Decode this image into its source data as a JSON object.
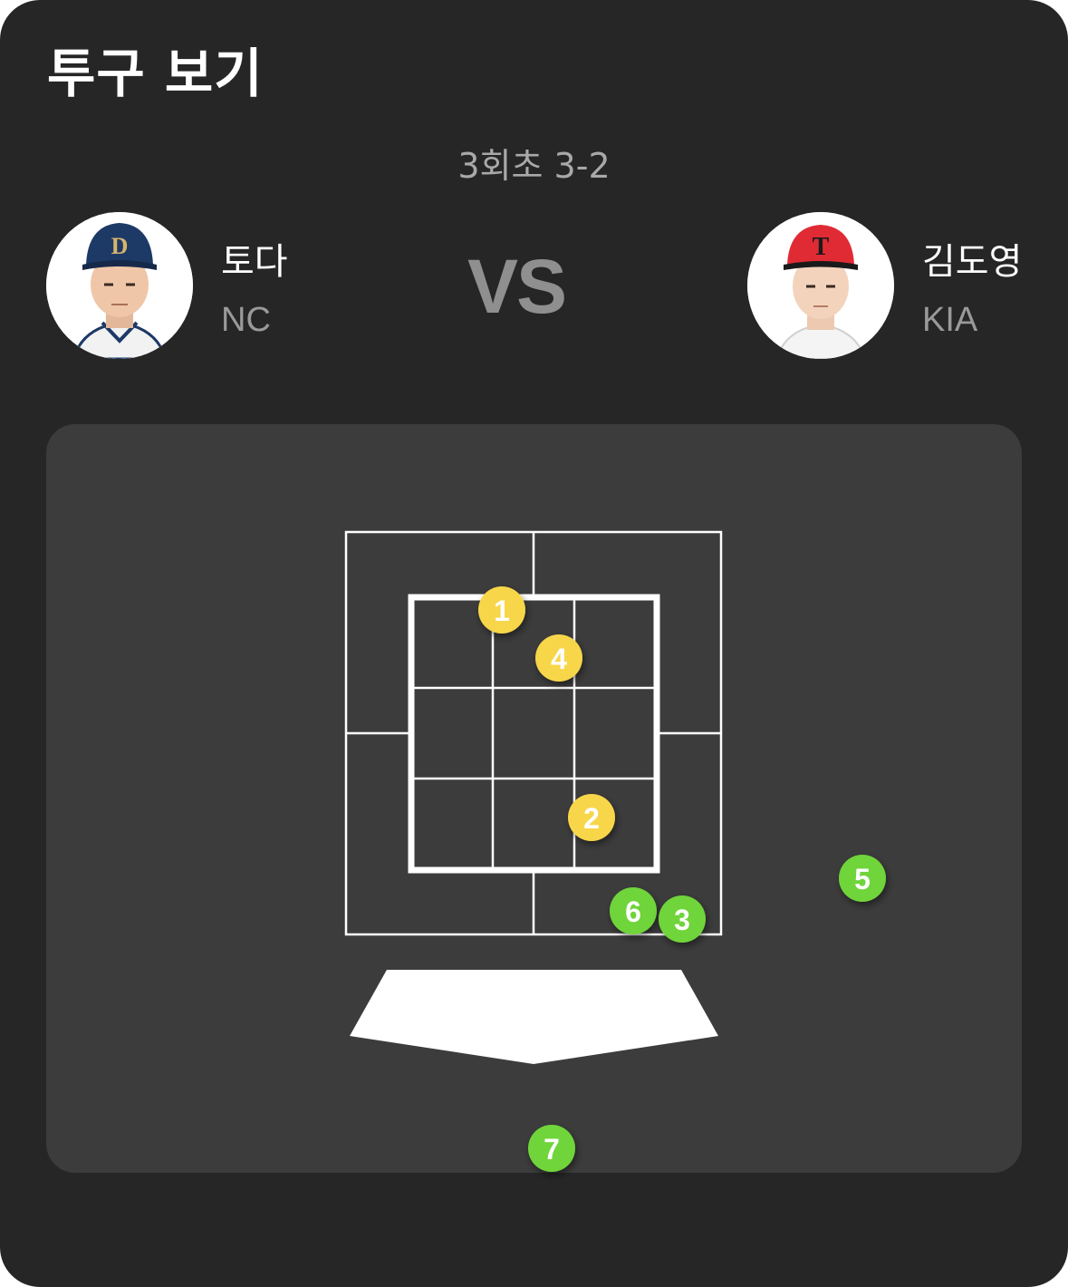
{
  "header": {
    "title": "투구 보기"
  },
  "game_state": {
    "inning_count": "3회초 3-2"
  },
  "matchup": {
    "vs_label": "VS",
    "pitcher": {
      "name": "토다",
      "team": "NC",
      "cap_color": "#1d3966",
      "cap_logo": "D"
    },
    "batter": {
      "name": "김도영",
      "team": "KIA",
      "cap_color": "#e02b35",
      "cap_logo": "T"
    }
  },
  "pitches": [
    {
      "number": "1",
      "result": "strike",
      "color": "#f7d64a"
    },
    {
      "number": "2",
      "result": "strike",
      "color": "#f7d64a"
    },
    {
      "number": "3",
      "result": "ball",
      "color": "#6fd43a"
    },
    {
      "number": "4",
      "result": "strike",
      "color": "#f7d64a"
    },
    {
      "number": "5",
      "result": "ball",
      "color": "#6fd43a"
    },
    {
      "number": "6",
      "result": "ball",
      "color": "#6fd43a"
    },
    {
      "number": "7",
      "result": "ball",
      "color": "#6fd43a"
    }
  ]
}
